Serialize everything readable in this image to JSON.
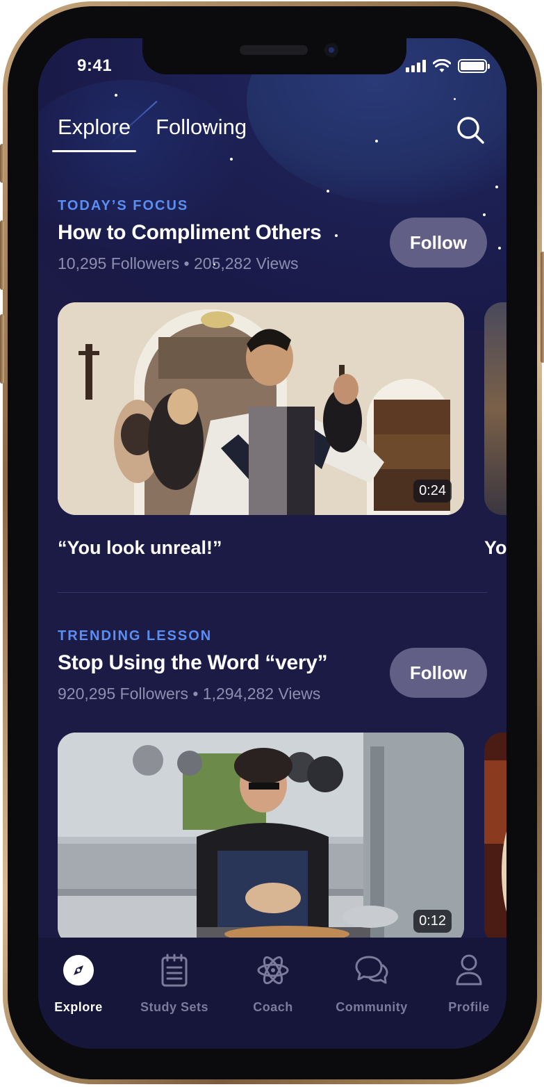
{
  "status_bar": {
    "time": "9:41"
  },
  "header": {
    "tabs": [
      {
        "label": "Explore",
        "active": true
      },
      {
        "label": "Following",
        "active": false
      }
    ],
    "search_icon": "search-icon"
  },
  "sections": [
    {
      "eyebrow": "TODAY’S FOCUS",
      "title": "How to Compliment Others",
      "meta": "10,295 Followers • 205,282 Views",
      "follow_label": "Follow",
      "video": {
        "duration": "0:24",
        "caption": "“You look unreal!”",
        "next_caption": "Yo"
      }
    },
    {
      "eyebrow": "TRENDING LESSON",
      "title": "Stop Using the Word “very”",
      "meta": "920,295 Followers • 1,294,282 Views",
      "follow_label": "Follow",
      "video": {
        "duration": "0:12"
      }
    }
  ],
  "tab_bar": {
    "items": [
      {
        "label": "Explore",
        "icon": "compass-icon",
        "active": true
      },
      {
        "label": "Study Sets",
        "icon": "notepad-icon",
        "active": false
      },
      {
        "label": "Coach",
        "icon": "atom-icon",
        "active": false
      },
      {
        "label": "Community",
        "icon": "chat-bubbles-icon",
        "active": false
      },
      {
        "label": "Profile",
        "icon": "person-icon",
        "active": false
      }
    ]
  },
  "colors": {
    "background": "#1c1b46",
    "accent": "#5b8ef2",
    "follow_button": "#625f86",
    "phone_frame": "#b89668"
  }
}
